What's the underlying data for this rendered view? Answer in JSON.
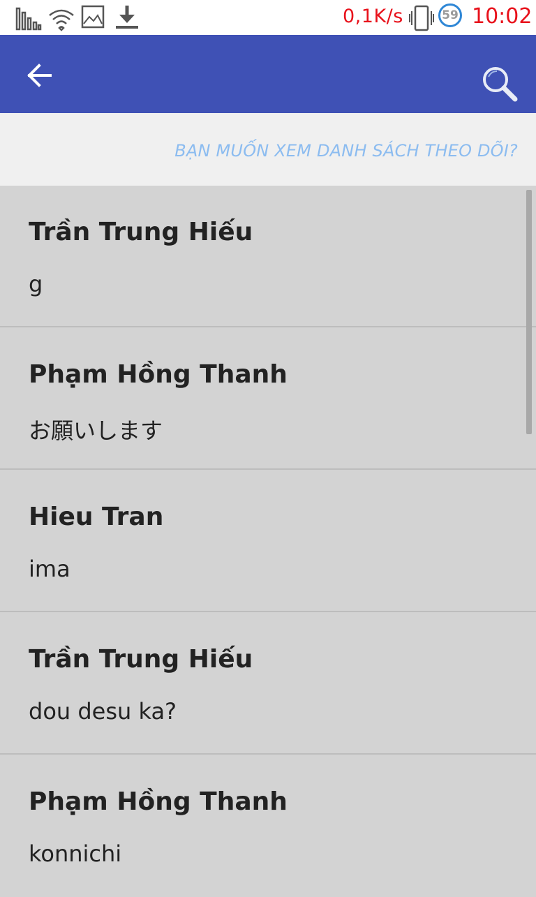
{
  "status_bar": {
    "network_speed": "0,1K/s",
    "badge_count": "59",
    "time": "10:02",
    "icons": [
      "signal-bars-icon",
      "wifi-icon",
      "image-icon",
      "download-icon",
      "vibrate-icon"
    ]
  },
  "app_bar": {
    "back_icon": "arrow-back-icon",
    "search_icon": "search-icon",
    "color": "#3f51b5"
  },
  "banner": {
    "text": "BẠN MUỐN XEM DANH SÁCH THEO DÕI?"
  },
  "messages": [
    {
      "name": "Trần Trung Hiếu",
      "text": "g"
    },
    {
      "name": "Phạm Hồng Thanh",
      "text": "お願いします"
    },
    {
      "name": "Hieu Tran",
      "text": "ima"
    },
    {
      "name": "Trần Trung Hiếu",
      "text": "dou desu ka?"
    },
    {
      "name": "Phạm Hồng Thanh",
      "text": "konnichi"
    }
  ],
  "colors": {
    "status_text": "#e8111b",
    "banner_text": "#8cbcf0",
    "list_background": "#d3d3d3"
  }
}
